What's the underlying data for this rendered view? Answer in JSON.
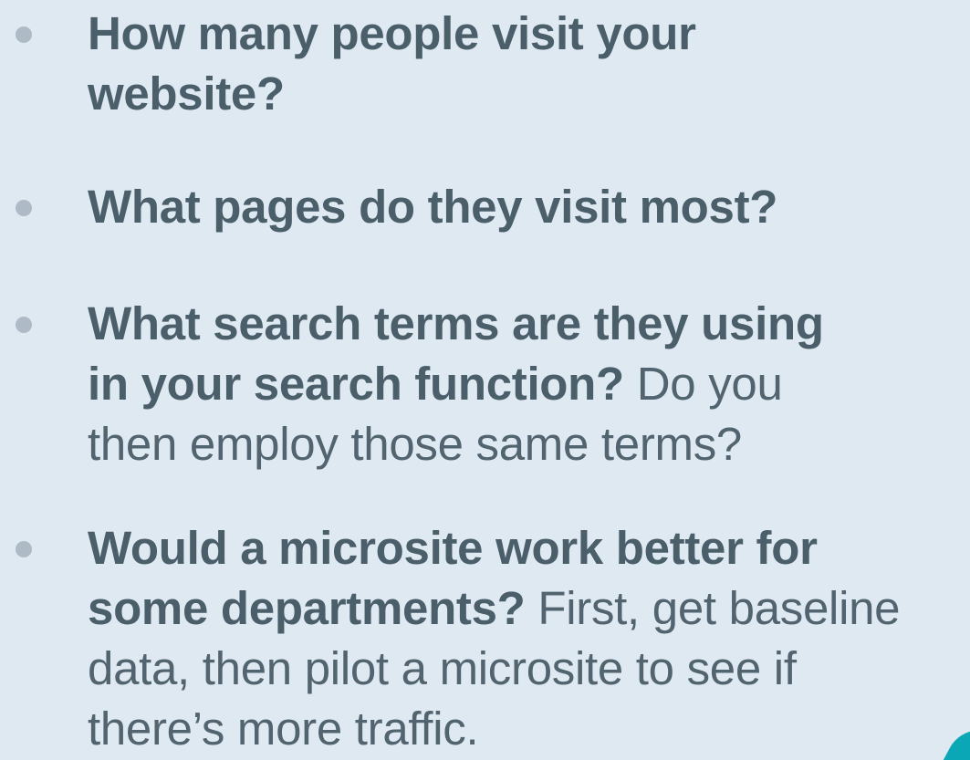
{
  "bullets": [
    {
      "bold_lines": [
        "How many people visit your",
        "website?"
      ],
      "light_lines": []
    },
    {
      "bold_lines": [
        "What pages do they visit most?"
      ],
      "light_lines": []
    },
    {
      "bold_lines": [
        "What search terms are they using",
        "in your search function?"
      ],
      "light_inline": " Do you",
      "light_lines": [
        "then employ those same terms?"
      ]
    },
    {
      "bold_lines": [
        "Would a microsite work better for",
        "some departments?"
      ],
      "light_inline": " First, get baseline",
      "light_lines": [
        "data, then pilot a microsite to see if",
        "there’s more traffic."
      ]
    }
  ],
  "accent_color": "#0aa8b7",
  "background_color": "#dfe9f1",
  "text_color": "#4b5f6b"
}
